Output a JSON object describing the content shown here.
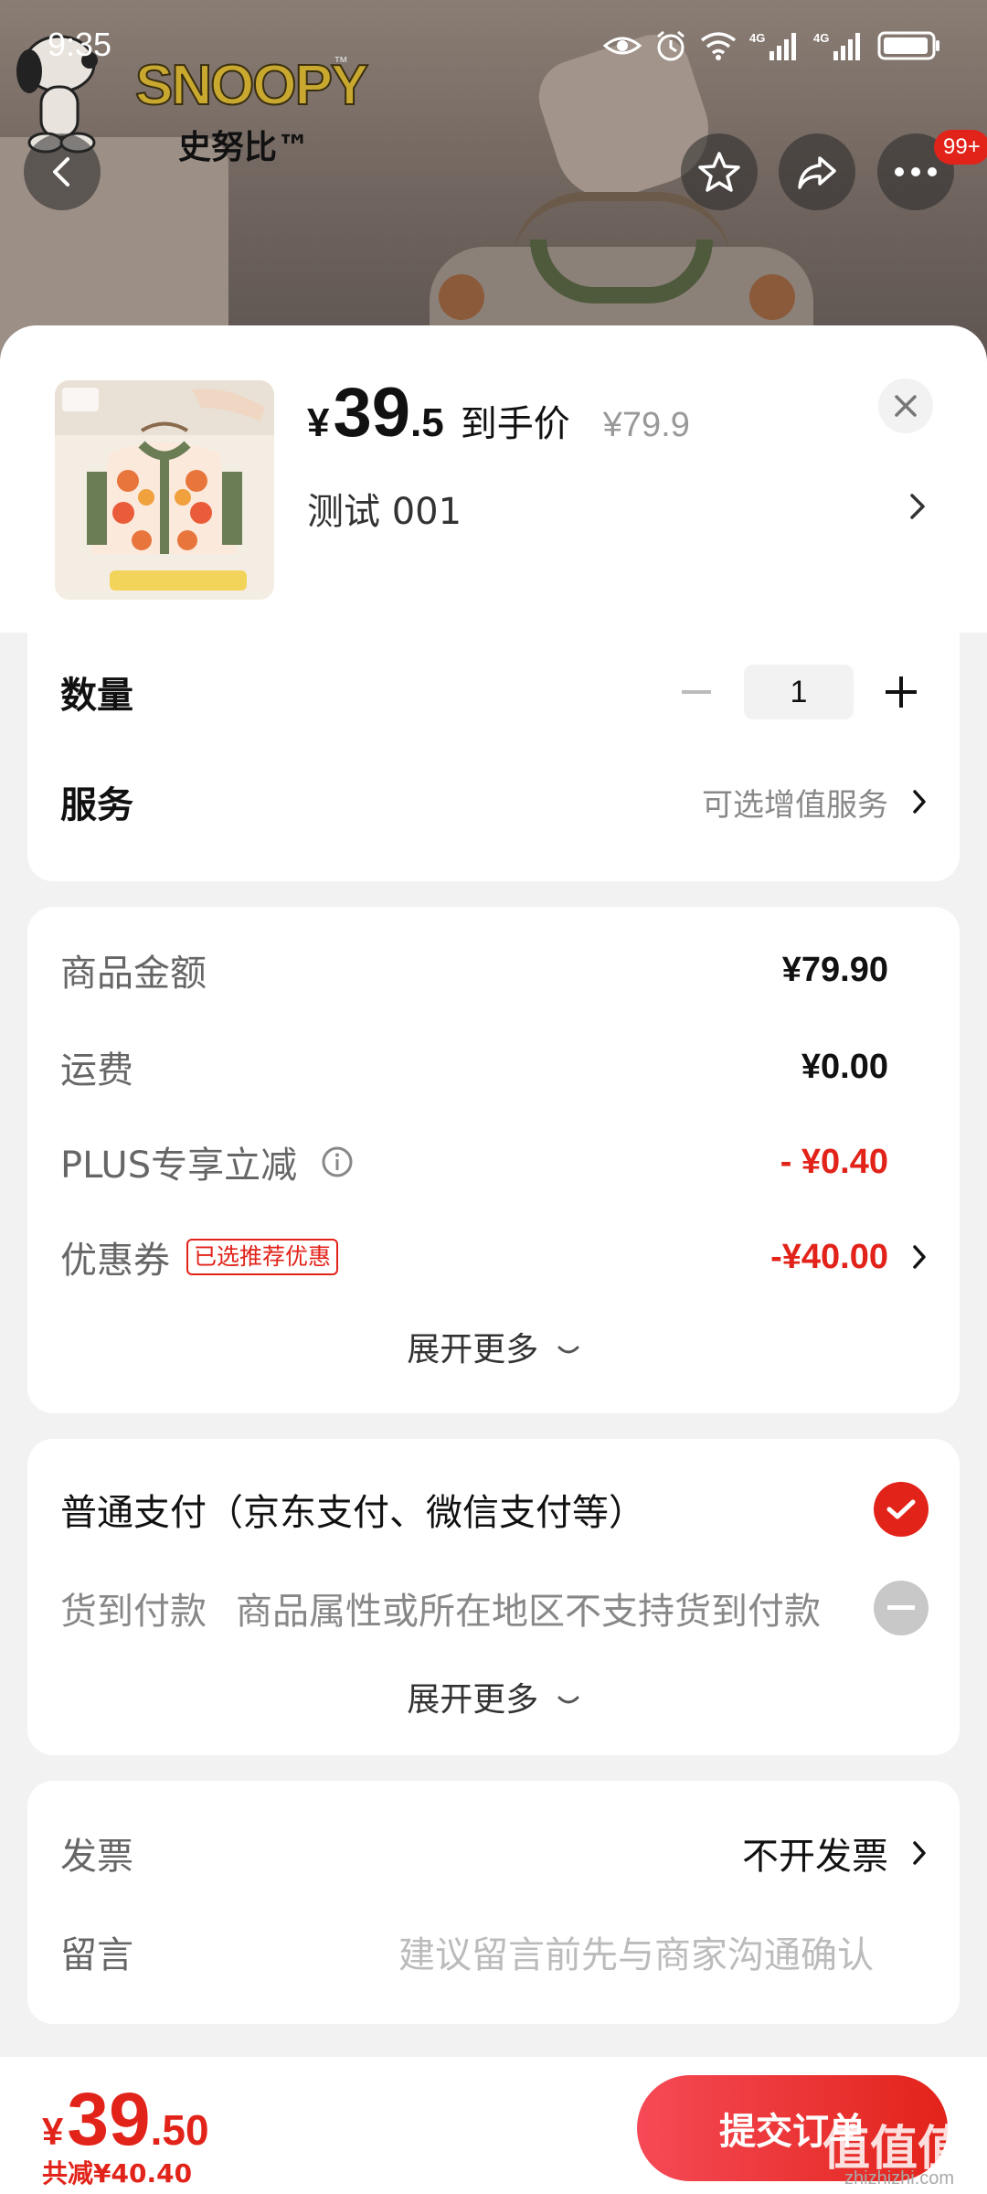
{
  "status_bar": {
    "time": "9:35",
    "network_1": "4G",
    "network_2": "4G"
  },
  "hero": {
    "brand": "SNOOPY",
    "brand_tm": "™",
    "brand_cn": "史努比™"
  },
  "top_nav": {
    "more_badge": "99+"
  },
  "product": {
    "currency": "¥",
    "price_int": "39",
    "price_dec": ".5",
    "price_label": "到手价",
    "original_price": "¥79.9",
    "spec": "测试  001"
  },
  "options": {
    "quantity_label": "数量",
    "quantity_value": "1",
    "service_label": "服务",
    "service_value": "可选增值服务"
  },
  "cost": {
    "goods_label": "商品金额",
    "goods_value": "¥79.90",
    "shipping_label": "运费",
    "shipping_value": "¥0.00",
    "plus_label": "PLUS专享立减",
    "plus_value": "- ¥0.40",
    "coupon_label": "优惠券",
    "coupon_tag": "已选推荐优惠",
    "coupon_value": "-¥40.00",
    "expand": "展开更多"
  },
  "payment": {
    "normal_label": "普通支付（京东支付、微信支付等）",
    "cod_label": "货到付款",
    "cod_desc": "商品属性或所在地区不支持货到付款",
    "expand": "展开更多"
  },
  "extra": {
    "invoice_label": "发票",
    "invoice_value": "不开发票",
    "remark_label": "留言",
    "remark_placeholder": "建议留言前先与商家沟通确认"
  },
  "bottom": {
    "currency": "¥",
    "total_int": "39",
    "total_dec": ".50",
    "saved": "共减¥40.40",
    "submit": "提交订单"
  },
  "watermark": {
    "text": "值值值",
    "site": "zhizhizhi.com"
  },
  "colors": {
    "accent_red": "#e2231a",
    "background": "#f2f2f2"
  }
}
